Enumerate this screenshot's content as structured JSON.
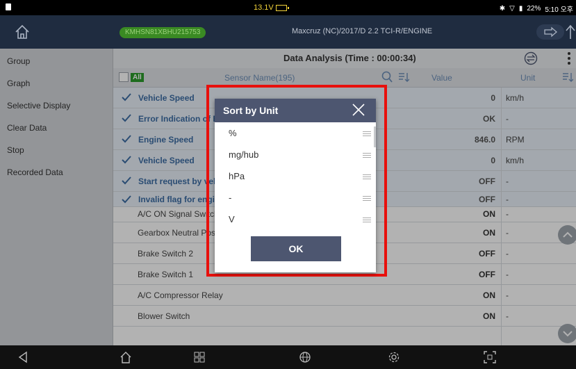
{
  "status_bar": {
    "voltage": "13.1V",
    "battery_pct": "22%",
    "time": "5:10 오후"
  },
  "header": {
    "vin": "KMHSN81XBHU215753",
    "vehicle": "Maxcruz (NC)/2017/D 2.2 TCI-R/ENGINE"
  },
  "sidebar": {
    "items": [
      {
        "label": "Group"
      },
      {
        "label": "Graph"
      },
      {
        "label": "Selective Display"
      },
      {
        "label": "Clear Data"
      },
      {
        "label": "Stop"
      },
      {
        "label": "Recorded Data"
      }
    ]
  },
  "main": {
    "title": "Data Analysis (Time : 00:00:34)",
    "columns": {
      "all": "All",
      "sensor_name": "Sensor Name(195)",
      "value": "Value",
      "unit": "Unit"
    },
    "rows": [
      {
        "name": "Vehicle Speed",
        "value": "0",
        "unit": "km/h",
        "selected": true
      },
      {
        "name": "Error Indication of BMS",
        "value": "OK",
        "unit": "-",
        "selected": true
      },
      {
        "name": "Engine Speed",
        "value": "846.0",
        "unit": "RPM",
        "selected": true
      },
      {
        "name": "Vehicle Speed",
        "value": "0",
        "unit": "km/h",
        "selected": true
      },
      {
        "name": "Start request by vehicle",
        "value": "OFF",
        "unit": "-",
        "selected": true
      },
      {
        "name": "Invalid flag for engine",
        "value": "OFF",
        "unit": "-",
        "selected": true
      },
      {
        "name": "A/C ON Signal Switch",
        "value": "ON",
        "unit": "-",
        "selected": false
      },
      {
        "name": "Gearbox Neutral Position",
        "value": "ON",
        "unit": "-",
        "selected": false
      },
      {
        "name": "Brake Switch 2",
        "value": "OFF",
        "unit": "-",
        "selected": false
      },
      {
        "name": "Brake Switch 1",
        "value": "OFF",
        "unit": "-",
        "selected": false
      },
      {
        "name": "A/C Compressor Relay",
        "value": "ON",
        "unit": "-",
        "selected": false
      },
      {
        "name": "Blower Switch",
        "value": "ON",
        "unit": "-",
        "selected": false
      }
    ]
  },
  "dialog": {
    "title": "Sort by Unit",
    "items": [
      "%",
      "mg/hub",
      "hPa",
      "-",
      "V"
    ],
    "ok_label": "OK"
  },
  "colors": {
    "header_bg": "#1f2c40",
    "dialog_header": "#4d5670",
    "highlight_frame": "#e8100c",
    "check_blue": "#3d6ea5"
  }
}
